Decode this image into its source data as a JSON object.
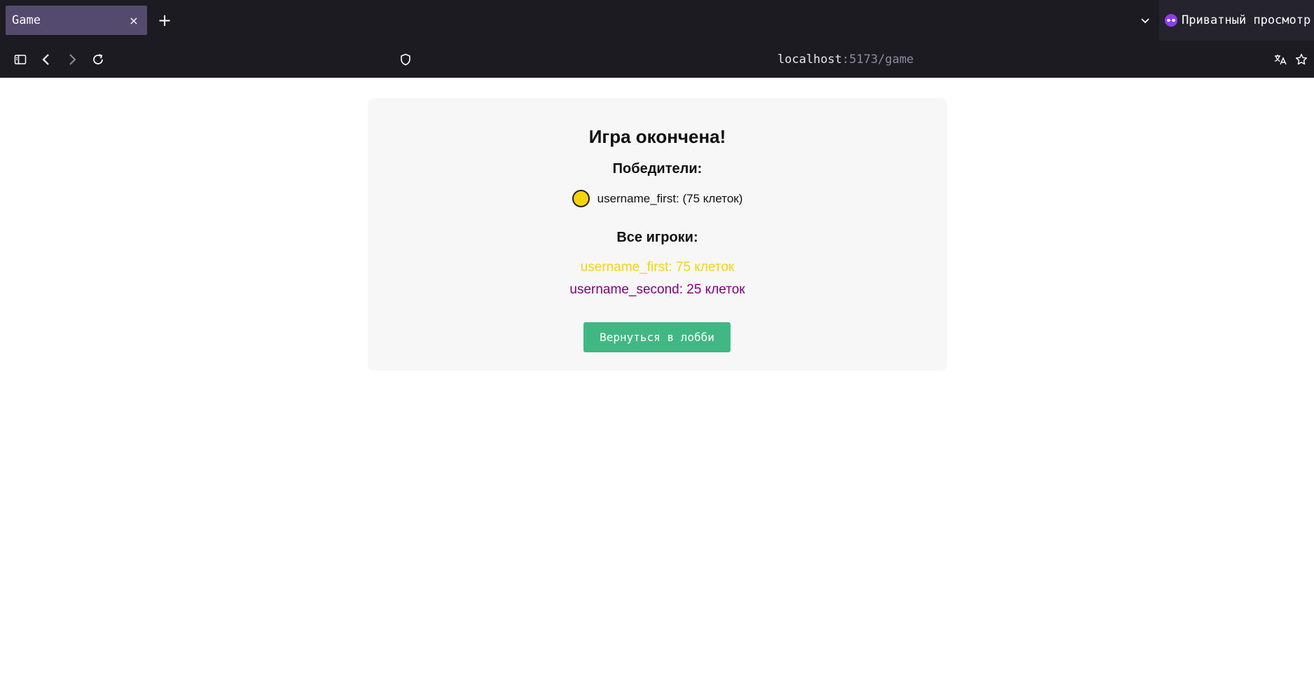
{
  "browser": {
    "tab": {
      "title": "Game",
      "close": "×"
    },
    "new_tab": "+",
    "private_label": "Приватный просмотр",
    "url": {
      "host": "localhost",
      "path": ":5173/game"
    }
  },
  "game_over": {
    "title": "Игра окончена!",
    "winners_heading": "Победители:",
    "winners": [
      {
        "text": "username_first: (75 клеток)",
        "color": "#f5d40f"
      }
    ],
    "all_players_heading": "Все игроки:",
    "players": [
      {
        "text": "username_first: 75 клеток",
        "color": "#f5d40f"
      },
      {
        "text": "username_second: 25 клеток",
        "color": "#800080"
      }
    ],
    "lobby_button": "Вернуться в лобби"
  },
  "colors": {
    "chrome_bg": "#1c1b22",
    "active_tab": "#544a6e",
    "button_green": "#41b883",
    "card_bg": "#f7f7f7"
  },
  "icons": [
    "sidebar-icon",
    "back-icon",
    "forward-icon",
    "reload-icon",
    "shield-icon",
    "chevron-down-icon",
    "private-mask-icon",
    "translate-icon",
    "bookmark-star-icon"
  ]
}
